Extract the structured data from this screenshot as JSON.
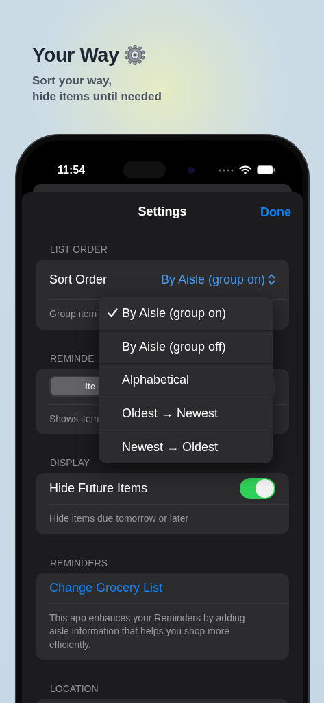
{
  "promo": {
    "title": "Your Way",
    "subtitle": "Sort your way,\nhide items until needed"
  },
  "status_bar": {
    "time": "11:54"
  },
  "nav": {
    "title": "Settings",
    "action": "Done"
  },
  "sections": [
    {
      "header": "LIST ORDER",
      "rows": [
        {
          "kind": "picker",
          "label": "Sort Order",
          "value": "By Aisle (group on)"
        }
      ],
      "footer": "Group item"
    },
    {
      "header": "REMINDE",
      "rows": [
        {
          "kind": "segmented",
          "segments": [
            {
              "label": "Ite",
              "selected": true
            }
          ]
        }
      ],
      "footer": "Shows item"
    },
    {
      "header": "DISPLAY",
      "rows": [
        {
          "kind": "toggle",
          "label": "Hide Future Items",
          "on": true
        }
      ],
      "footer": "Hide items due tomorrow or later"
    },
    {
      "header": "REMINDERS",
      "rows": [
        {
          "kind": "link",
          "label": "Change Grocery List"
        }
      ],
      "footer": "This app enhances your Reminders by adding aisle information that helps you shop more efficiently."
    },
    {
      "header": "LOCATION"
    }
  ],
  "menu": {
    "items": [
      {
        "label": "By Aisle (group on)",
        "selected": true
      },
      {
        "label": "By Aisle (group off)",
        "selected": false
      },
      {
        "label": "Alphabetical",
        "selected": false
      },
      {
        "label": "Oldest → Newest",
        "selected": false
      },
      {
        "label": "Newest → Oldest",
        "selected": false
      }
    ]
  }
}
